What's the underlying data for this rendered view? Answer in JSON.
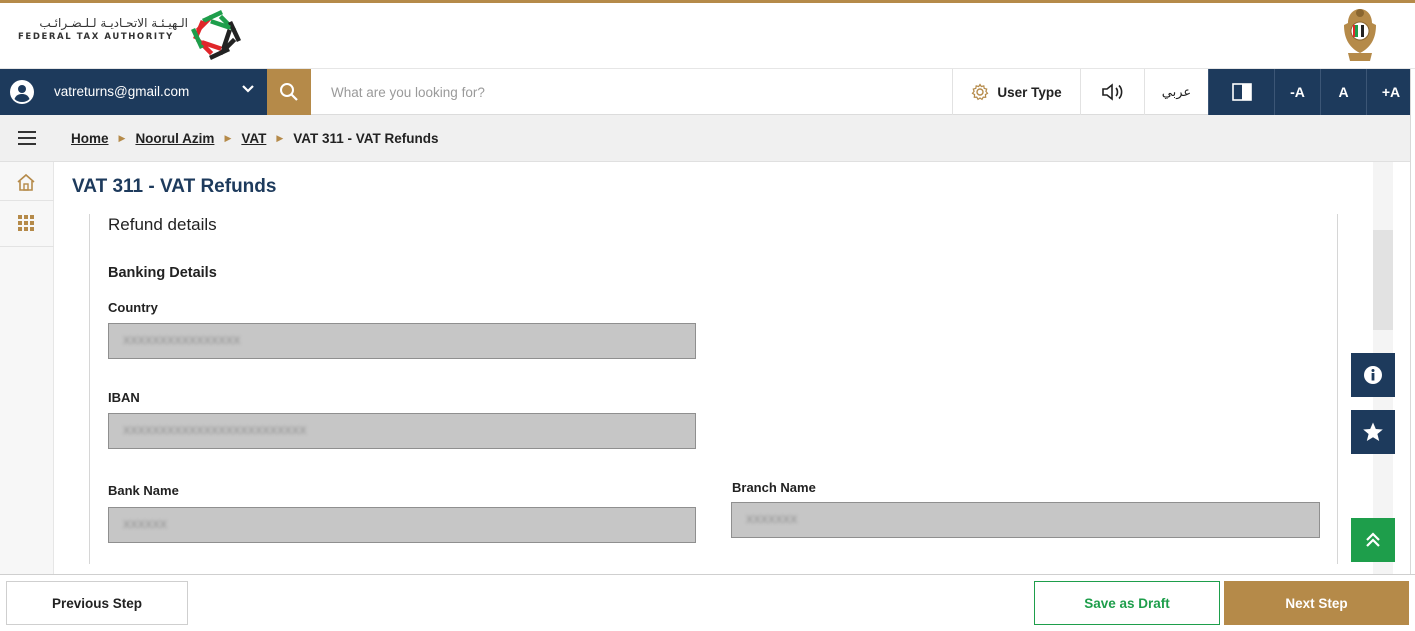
{
  "header": {
    "logo_arabic": "الـهيـئـة الاتحـاديـة لـلـضـرائـب",
    "logo_english": "FEDERAL TAX AUTHORITY"
  },
  "toolbar": {
    "email": "vatreturns@gmail.com",
    "search_placeholder": "What are you looking for?",
    "user_type_label": "User Type",
    "arabic_label": "عربي",
    "font_decrease": "-A",
    "font_normal": "A",
    "font_increase": "+A"
  },
  "breadcrumb": {
    "items": [
      "Home",
      "Noorul Azim",
      "VAT"
    ],
    "current": "VAT 311 - VAT Refunds"
  },
  "page": {
    "title": "VAT 311 - VAT Refunds",
    "section_title": "Refund details",
    "subsection_title": "Banking Details"
  },
  "fields": {
    "country": {
      "label": "Country",
      "value": "XXXXXXXXXXXXXXXX"
    },
    "iban": {
      "label": "IBAN",
      "value": "XXXXXXXXXXXXXXXXXXXXXXXXX"
    },
    "bank_name": {
      "label": "Bank Name",
      "value": "XXXXXX"
    },
    "branch_name": {
      "label": "Branch Name",
      "value": "XXXXXXX"
    }
  },
  "footer": {
    "previous_label": "Previous Step",
    "draft_label": "Save as Draft",
    "next_label": "Next Step"
  },
  "colors": {
    "navy": "#1d3a5c",
    "gold": "#b58a49",
    "green": "#1e9e4b"
  },
  "icons": {
    "account": "user-circle-icon",
    "dropdown": "chevron-down-icon",
    "search": "search-icon",
    "user_type": "gear-icon",
    "sound": "speaker-icon",
    "contrast": "contrast-icon",
    "menu": "hamburger-icon",
    "home": "home-icon",
    "apps": "grid-icon",
    "info": "info-icon",
    "favorite": "star-icon",
    "scroll_top": "double-chevron-up-icon"
  }
}
